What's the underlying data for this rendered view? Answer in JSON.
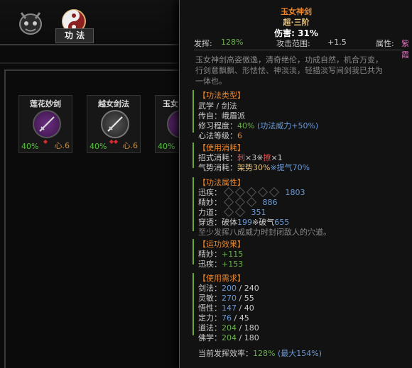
{
  "tabs": {
    "gongfa_label": "功 法"
  },
  "cards": [
    {
      "title": "莲花妙剑",
      "percent": "40%",
      "xin": "心.6",
      "diamonds": "◆"
    },
    {
      "title": "越女剑法",
      "percent": "40%",
      "xin": "心.6",
      "diamonds": "◆◆"
    },
    {
      "title": "玉女",
      "percent": "40%",
      "xin": "",
      "diamonds": ""
    }
  ],
  "panel": {
    "title": "玉女神剑",
    "grade": "超·三阶",
    "damage": "伤害: 31%",
    "fa_hui_label": "发挥:",
    "fa_hui_value": "128%",
    "range_label": "攻击范围:",
    "range_value": "+1.5",
    "attr_label": "属性:",
    "attr_value": "紫霞",
    "desc_1": "玉女神剑高姿傲逸，清奇绝伦，功成自然，机合万变，",
    "desc_2": "行剑意飘飘、形怯怯、神淡淡，轻描淡写间剑我已共为",
    "desc_3": "一体也。",
    "sec_type": "【功法类型】",
    "type_1": "武学 / 剑法",
    "type_2": "传自：峨眉派",
    "type_3_label": "修习程度：",
    "type_3_value": "40%",
    "type_3_extra": "(功法威力+50%)",
    "type_4_label": "心法等级：",
    "type_4_value": "6",
    "sec_cost": "【使用消耗】",
    "cost_1_label": "招式消耗：",
    "cost_1_a": "刺",
    "cost_1_b": "×3※",
    "cost_1_c": "撩",
    "cost_1_d": "×1",
    "cost_2_label": "气势消耗：",
    "cost_2_a": "架势30%",
    "cost_2_b": "※提气70%",
    "sec_attr": "【功法属性】",
    "attr_1_label": "迅疾：",
    "attr_1_value": "1803",
    "attr_2_label": "精妙：",
    "attr_2_value": "886",
    "attr_3_label": "力道：",
    "attr_3_value": "351",
    "attr_4_label": "穿透：",
    "attr_4_a": "破体",
    "attr_4_b": "199",
    "attr_4_c": "※破气",
    "attr_4_d": "655",
    "attr_5": "至少发挥八成威力时封闭敌人的穴道。",
    "sec_effect": "【运功效果】",
    "eff_1_label": "精妙：",
    "eff_1_value": "+115",
    "eff_2_label": "迅疾：",
    "eff_2_value": "+153",
    "sec_req": "【使用需求】",
    "req": [
      {
        "label": "剑法：",
        "cur": "200",
        "max": "240"
      },
      {
        "label": "灵敏：",
        "cur": "270",
        "max": "55"
      },
      {
        "label": "悟性：",
        "cur": "147",
        "max": "40"
      },
      {
        "label": "定力：",
        "cur": "76",
        "max": "45"
      },
      {
        "label": "道法：",
        "cur": "204",
        "max": "180"
      },
      {
        "label": "佛学：",
        "cur": "204",
        "max": "180"
      }
    ],
    "eff_rate_label": "当前发挥效率：",
    "eff_rate_value": "128%",
    "eff_rate_max": "(最大154%)"
  },
  "colors": {
    "orange": "#e7862f",
    "green": "#6ab04c",
    "blue": "#6a9ad8",
    "red": "#e04848",
    "purple": "#7a3a8e"
  }
}
